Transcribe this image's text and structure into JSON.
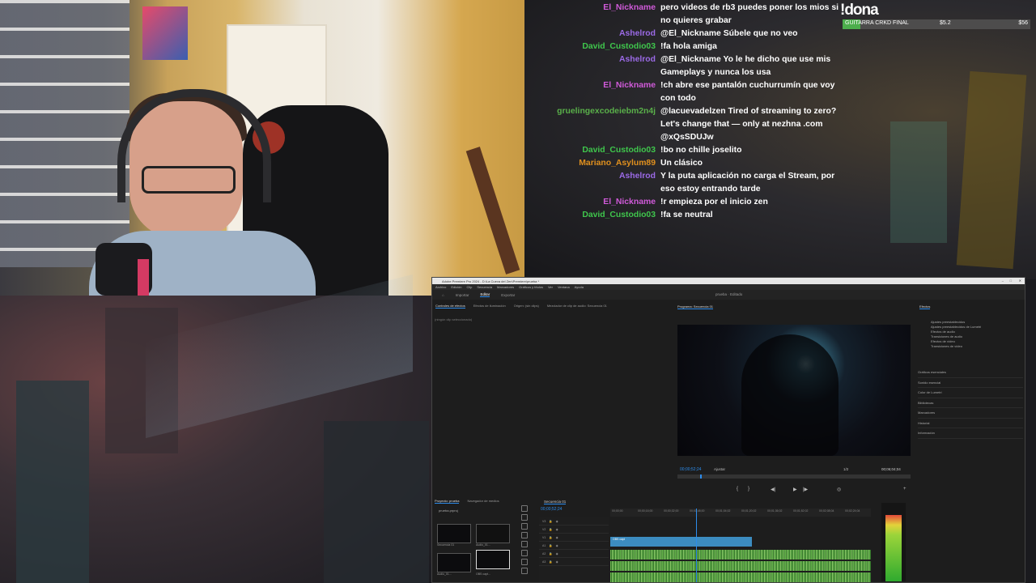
{
  "chat": {
    "messages": [
      {
        "user": "El_Nickname",
        "color": "#d05ad9",
        "text": "pero videos de rb3 puedes poner los mios si no quieres grabar"
      },
      {
        "user": "Ashelrod",
        "color": "#9b6ae6",
        "text": "@El_Nickname Súbele que no veo"
      },
      {
        "user": "David_Custodio03",
        "color": "#3fc64c",
        "text": "!fa hola amiga"
      },
      {
        "user": "Ashelrod",
        "color": "#9b6ae6",
        "text": "@El_Nickname Yo le he dicho que use mis Gameplays y nunca los usa"
      },
      {
        "user": "El_Nickname",
        "color": "#d05ad9",
        "text": "!ch abre ese pantalón cuchurrumín que voy con todo"
      },
      {
        "user": "gruelingexcodeiebm2n4j",
        "color": "#5ab04a",
        "text": "@lacuevadelzen Tired of streaming to zero? Let's change that — only at nezhna .com @xQsSDUJw"
      },
      {
        "user": "David_Custodio03",
        "color": "#3fc64c",
        "text": "!bo no chille joselito"
      },
      {
        "user": "Mariano_Asylum89",
        "color": "#e0901e",
        "text": "Un clásico"
      },
      {
        "user": "Ashelrod",
        "color": "#9b6ae6",
        "text": "Y la puta aplicación no carga el Stream, por eso estoy entrando tarde"
      },
      {
        "user": "El_Nickname",
        "color": "#d05ad9",
        "text": "!r empieza por el inicio zen"
      },
      {
        "user": "David_Custodio03",
        "color": "#3fc64c",
        "text": "!fa se neutral"
      }
    ]
  },
  "donation": {
    "title": "!dona",
    "goal_label": "GUITARRA CRKD FINAL",
    "current": "$5.2",
    "goal": "$56",
    "progress_fraction": 0.093
  },
  "premiere": {
    "title": "Adobe Premiere Pro 2024 - D:\\La Cueva del Zen\\Premiere\\prueba *",
    "menus": [
      "Archivo",
      "Edición",
      "Clip",
      "Secuencia",
      "Marcadores",
      "Gráficos y títulos",
      "Ver",
      "Ventana",
      "Ayuda"
    ],
    "workspaces": [
      "Importar",
      "Editar",
      "Exportar"
    ],
    "active_workspace": "Editar",
    "center_label": "prueba",
    "center_label2": "Editado",
    "source_tabs": [
      "Controles de efectos",
      "Mezclador de clip de audio: Secuencia 01"
    ],
    "source_tabs_extra": [
      "Efectos de iluminación",
      "Origen: (sin clips)"
    ],
    "no_selection": "(ningún clip seleccionado)",
    "program_label": "Programa: Secuencia 01",
    "timecode": "00;00;52;24",
    "fit": "Ajustar",
    "fraction": "1/2",
    "duration": "00;06;04;04",
    "effects_title": "Efectos",
    "effects_items": [
      "Ajustes preestablecidos",
      "Ajustes preestablecidos de Lumetri",
      "Efectos de audio",
      "Transiciones de audio",
      "Efectos de vídeo",
      "Transiciones de vídeo"
    ],
    "effects_sections": [
      "Gráficos esenciales",
      "Sonido esencial",
      "Color de Lumetri",
      "Bibliotecas",
      "Marcadores",
      "Historial",
      "Información"
    ],
    "project_tabs": [
      "Proyecto: prueba",
      "Navegador de medios"
    ],
    "project_name": "prueba.prproj",
    "thumbs": [
      {
        "label": "Secuencia 01",
        "meta": "6:04:04"
      },
      {
        "label": "Audio_01...",
        "meta": "6:04:03"
      },
      {
        "label": "Audio_01...",
        "meta": "15:03:03"
      },
      {
        "label": "OBS capt...",
        "meta": "6:04:04"
      }
    ],
    "timeline_name": "Secuencia 01",
    "timeline_time": "00;00;52;24",
    "ruler": [
      "00;00;00",
      "00;00;16;00",
      "00;00;32;00",
      "00;00;48;00",
      "00;01;04;02",
      "00;01;20;02",
      "00;01;36;02",
      "00;01;52;02",
      "00;02;08;04",
      "00;02;24;04"
    ],
    "tracks": [
      "V3",
      "V2",
      "V1",
      "A1",
      "A2",
      "A3"
    ],
    "clip_label": "OBS capt",
    "meter_level": 0.85
  }
}
